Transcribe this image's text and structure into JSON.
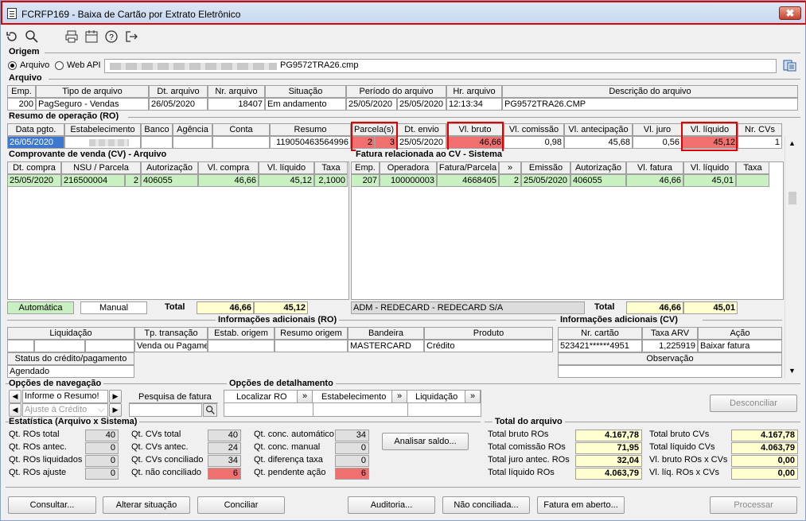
{
  "window": {
    "title": "FCRFP169 - Baixa de Cartão por Extrato Eletrônico",
    "close_label": "✖"
  },
  "origem": {
    "title": "Origem",
    "radio_arquivo": "Arquivo",
    "radio_webapi": "Web API",
    "path_suffix": "PG9572TRA26.cmp"
  },
  "arquivo": {
    "title": "Arquivo",
    "headers": [
      "Emp.",
      "Tipo de arquivo",
      "Dt. arquivo",
      "Nr. arquivo",
      "Situação",
      "Período do arquivo",
      "Hr. arquivo",
      "Descrição do arquivo"
    ],
    "row": {
      "emp": "200",
      "tipo": "PagSeguro - Vendas",
      "dt": "26/05/2020",
      "nr": "18407",
      "situacao": "Em andamento",
      "periodo_ini": "25/05/2020",
      "periodo_fim": "25/05/2020",
      "hr": "12:13:34",
      "descricao": "PG9572TRA26.CMP"
    }
  },
  "ro": {
    "title": "Resumo de operação (RO)",
    "headers": [
      "Data pgto.",
      "Estabelecimento",
      "Banco",
      "Agência",
      "Conta",
      "Resumo",
      "Parcela(s)",
      "Dt. envio",
      "Vl. bruto",
      "Vl. comissão",
      "Vl. antecipação",
      "Vl. juro",
      "Vl. líquido",
      "Nr. CVs"
    ],
    "row": {
      "data": "26/05/2020",
      "resumo": "119050463564996",
      "parc_a": "2",
      "parc_b": "3",
      "dt_envio": "25/05/2020",
      "bruto": "46,66",
      "comissao": "0,98",
      "antecipacao": "45,68",
      "juro": "0,56",
      "liquido": "45,12",
      "nr_cvs": "1"
    }
  },
  "cv": {
    "title": "Comprovante de venda (CV) - Arquivo",
    "headers": [
      "Dt. compra",
      "NSU / Parcela",
      "Autorização",
      "Vl. compra",
      "Vl. líquido",
      "Taxa"
    ],
    "row": {
      "dt": "25/05/2020",
      "nsu": "216500004",
      "parcela": "2",
      "aut": "406055",
      "compra": "46,66",
      "liquido": "45,12",
      "taxa": "2,1000"
    },
    "btn_auto": "Automática",
    "btn_manual": "Manual",
    "total_label": "Total",
    "total_compra": "46,66",
    "total_liquido": "45,12"
  },
  "fatura": {
    "title": "Fatura relacionada ao CV - Sistema",
    "headers": [
      "Emp.",
      "Operadora",
      "Fatura/Parcela",
      "»",
      "Emissão",
      "Autorização",
      "Vl. fatura",
      "Vl. líquido",
      "Taxa"
    ],
    "row": {
      "emp": "207",
      "operadora": "100000003",
      "fatura": "4668405",
      "parcela": "2",
      "emissao": "25/05/2020",
      "aut": "406055",
      "vl_fatura": "46,66",
      "liquido": "45,01"
    },
    "operadora_desc": "ADM - REDECARD - REDECARD S/A",
    "total_label": "Total",
    "total_fatura": "46,66",
    "total_liquido": "45,01"
  },
  "info_ro": {
    "title": "Informações adicionais (RO)",
    "headers": [
      "Liquidação",
      "Tp. transação",
      "Estab. origem",
      "Resumo origem",
      "Bandeira",
      "Produto"
    ],
    "row": {
      "tp": "Venda ou Pagame",
      "bandeira": "MASTERCARD",
      "produto": "Crédito"
    },
    "status_header": "Status do crédito/pagamento",
    "status": "Agendado"
  },
  "info_cv": {
    "title": "Informações adicionais (CV)",
    "headers": [
      "Nr. cartão",
      "Taxa ARV",
      "Ação"
    ],
    "row": {
      "cartao": "523421******4951",
      "taxa": "1,225919",
      "acao": "Baixar fatura"
    },
    "obs_header": "Observação"
  },
  "nav": {
    "title": "Opções de navegação",
    "input_value": "Informe o Resumo!",
    "dropdown": "Ajuste à Crédito",
    "pesquisa": "Pesquisa de fatura"
  },
  "det": {
    "title": "Opções de detalhamento",
    "loc_ro": "Localizar RO",
    "estab": "Estabelecimento",
    "liq": "Liquidação"
  },
  "desconciliar": "Desconciliar",
  "stats": {
    "title": "Estatística (Arquivo x Sistema)",
    "c1": [
      {
        "l": "Qt. ROs total",
        "v": "40"
      },
      {
        "l": "Qt. ROs antec.",
        "v": "0"
      },
      {
        "l": "Qt. ROs liquidados",
        "v": "0"
      },
      {
        "l": "Qt. ROs ajuste",
        "v": "0"
      }
    ],
    "c2": [
      {
        "l": "Qt. CVs total",
        "v": "40"
      },
      {
        "l": "Qt. CVs antec.",
        "v": "24"
      },
      {
        "l": "Qt. CVs conciliado",
        "v": "34"
      },
      {
        "l": "Qt. não conciliado",
        "v": "6"
      }
    ],
    "c3": [
      {
        "l": "Qt. conc. automático",
        "v": "34"
      },
      {
        "l": "Qt. conc. manual",
        "v": "0"
      },
      {
        "l": "Qt. diferença taxa",
        "v": "0"
      },
      {
        "l": "Qt. pendente ação",
        "v": "6"
      }
    ],
    "analisar": "Analisar saldo..."
  },
  "totais": {
    "title": "Total do arquivo",
    "c1": [
      {
        "l": "Total bruto ROs",
        "v": "4.167,78"
      },
      {
        "l": "Total comissão ROs",
        "v": "71,95"
      },
      {
        "l": "Total juro antec. ROs",
        "v": "32,04"
      },
      {
        "l": "Total líquido ROs",
        "v": "4.063,79"
      }
    ],
    "c2": [
      {
        "l": "Total bruto CVs",
        "v": "4.167,78"
      },
      {
        "l": "Total líquido CVs",
        "v": "4.063,79"
      },
      {
        "l": "Vl. bruto ROs x CVs",
        "v": "0,00"
      },
      {
        "l": "Vl. líq. ROs x CVs",
        "v": "0,00"
      }
    ]
  },
  "bottom": {
    "consultar": "Consultar...",
    "alterar": "Alterar situação",
    "conciliar": "Conciliar",
    "auditoria": "Auditoria...",
    "nao_conc": "Não conciliada...",
    "fatura_aberto": "Fatura em aberto...",
    "processar": "Processar"
  }
}
